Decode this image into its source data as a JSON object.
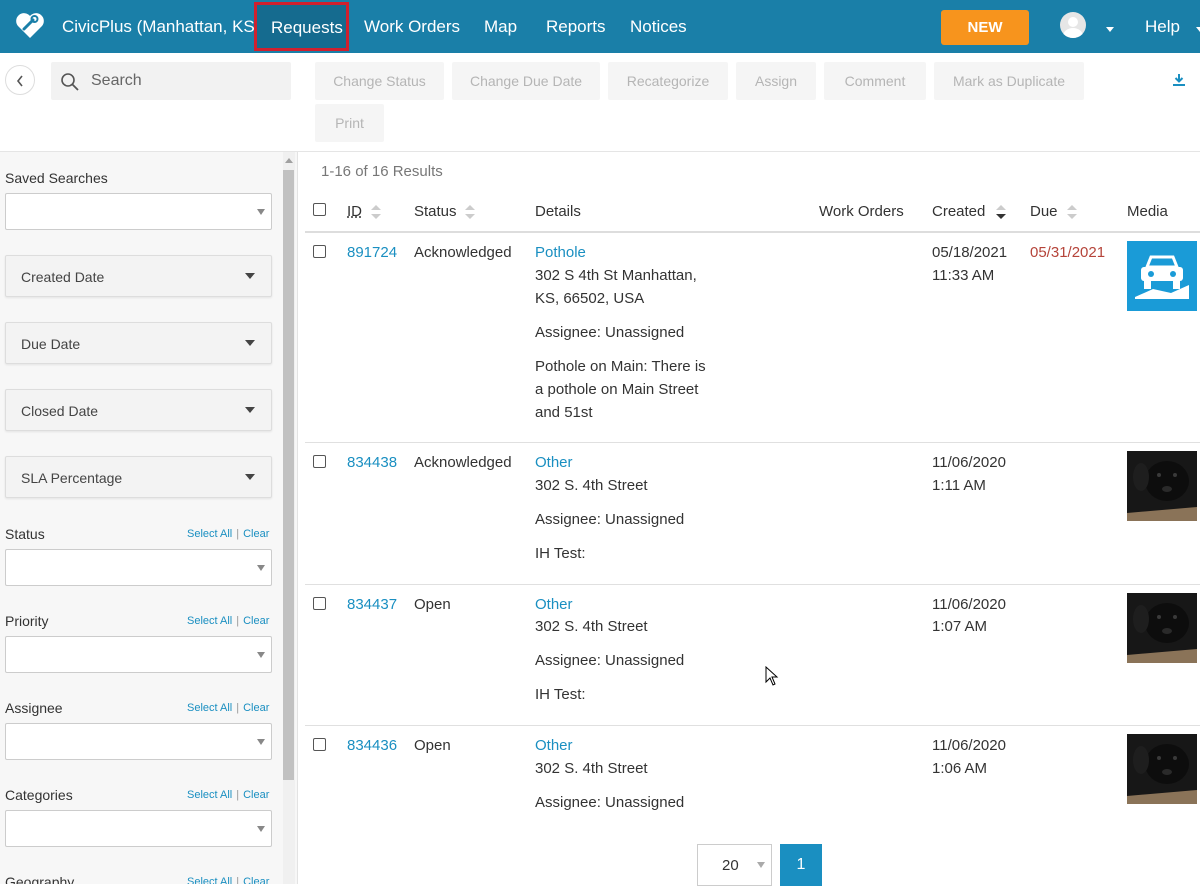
{
  "header": {
    "brand": "CivicPlus (Manhattan, KS)",
    "nav": [
      "Requests",
      "Work Orders",
      "Map",
      "Reports",
      "Notices"
    ],
    "new_label": "NEW",
    "help_label": "Help"
  },
  "toolbar": {
    "search_placeholder": "Search",
    "actions": [
      "Change Status",
      "Change Due Date",
      "Recategorize",
      "Assign",
      "Comment",
      "Mark as Duplicate",
      "Print"
    ]
  },
  "sidebar": {
    "saved_searches_label": "Saved Searches",
    "date_panels": [
      "Created Date",
      "Due Date",
      "Closed Date",
      "SLA Percentage"
    ],
    "filters": [
      {
        "label": "Status"
      },
      {
        "label": "Priority"
      },
      {
        "label": "Assignee"
      },
      {
        "label": "Categories"
      },
      {
        "label": "Geography"
      }
    ],
    "select_all": "Select All",
    "clear": "Clear",
    "separator": "|"
  },
  "results": {
    "count_text": "1-16 of 16 Results",
    "columns": [
      "ID",
      "Status",
      "Details",
      "Work Orders",
      "Created",
      "Due",
      "Media"
    ],
    "rows": [
      {
        "id": "891724",
        "status": "Acknowledged",
        "category": "Pothole",
        "address_lines": [
          "302 S 4th St Manhattan,",
          "KS, 66502, USA"
        ],
        "assignee": "Assignee: Unassigned",
        "description_lines": [
          "Pothole on Main: There is",
          "a pothole on Main Street",
          "and 51st"
        ],
        "created_date": "05/18/2021",
        "created_time": "11:33 AM",
        "due": "05/31/2021",
        "media": "car-icon"
      },
      {
        "id": "834438",
        "status": "Acknowledged",
        "category": "Other",
        "address_lines": [
          "302 S. 4th Street"
        ],
        "assignee": "Assignee: Unassigned",
        "description_lines": [
          "IH Test:"
        ],
        "created_date": "11/06/2020",
        "created_time": "1:11 AM",
        "due": "",
        "media": "dog-photo"
      },
      {
        "id": "834437",
        "status": "Open",
        "category": "Other",
        "address_lines": [
          "302 S. 4th Street"
        ],
        "assignee": "Assignee: Unassigned",
        "description_lines": [
          "IH Test:"
        ],
        "created_date": "11/06/2020",
        "created_time": "1:07 AM",
        "due": "",
        "media": "dog-photo"
      },
      {
        "id": "834436",
        "status": "Open",
        "category": "Other",
        "address_lines": [
          "302 S. 4th Street"
        ],
        "assignee": "Assignee: Unassigned",
        "description_lines": [],
        "created_date": "11/06/2020",
        "created_time": "1:06 AM",
        "due": "",
        "media": "dog-photo"
      }
    ]
  },
  "pager": {
    "page_size": "20",
    "current_page": "1"
  },
  "colors": {
    "topbar": "#1a7fa8",
    "accent_link": "#1a8fc1",
    "new_button": "#f7941d",
    "active_outline": "#d0202e",
    "overdue": "#b5443a"
  }
}
